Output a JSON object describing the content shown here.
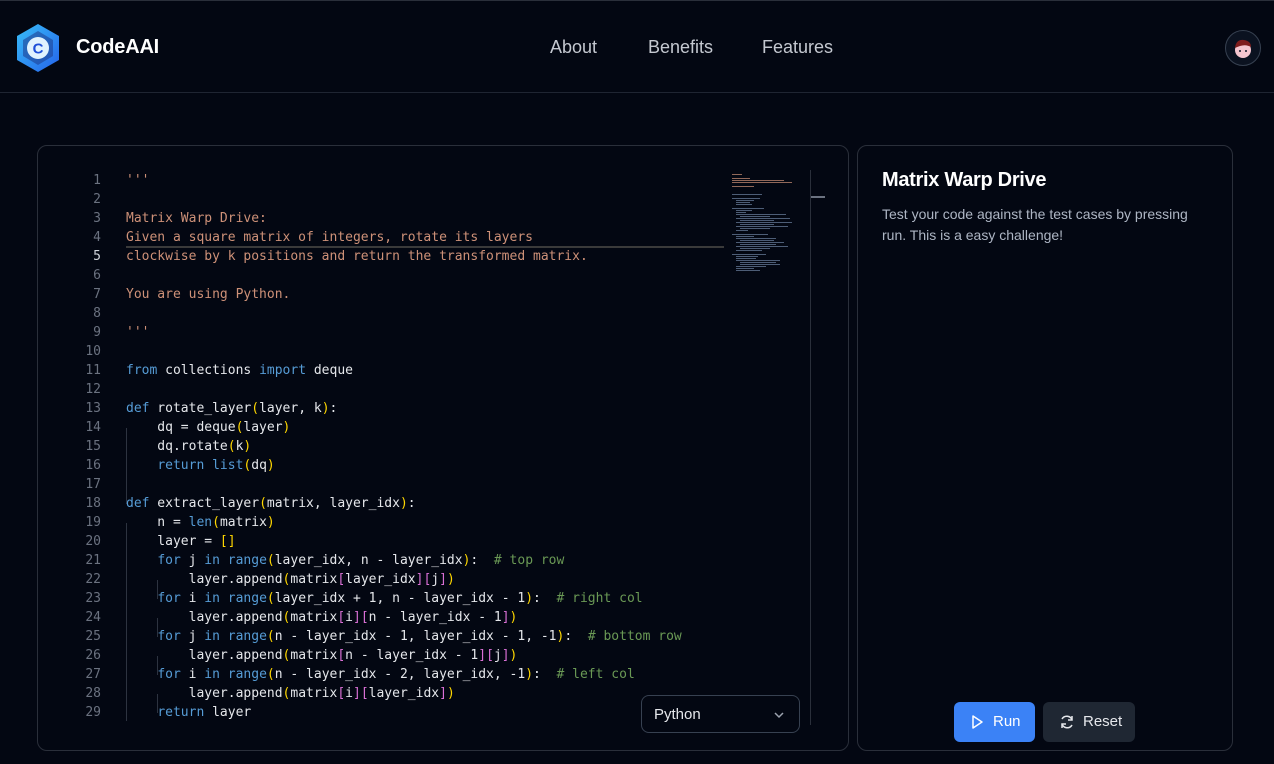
{
  "header": {
    "brand": "CodeAAI",
    "logo_letter": "C",
    "nav": [
      "About",
      "Benefits",
      "Features"
    ]
  },
  "editor": {
    "lines": [
      {
        "n": "1",
        "segs": [
          {
            "t": "'''",
            "c": "doc"
          }
        ]
      },
      {
        "n": "2",
        "segs": []
      },
      {
        "n": "3",
        "segs": [
          {
            "t": "Matrix Warp Drive:",
            "c": "doc"
          }
        ]
      },
      {
        "n": "4",
        "segs": [
          {
            "t": "Given a square matrix of integers, rotate its layers",
            "c": "doc"
          }
        ]
      },
      {
        "n": "5",
        "segs": [
          {
            "t": "clockwise by k positions and return the transformed matrix.",
            "c": "doc"
          }
        ]
      },
      {
        "n": "6",
        "segs": []
      },
      {
        "n": "7",
        "segs": [
          {
            "t": "You are using Python.",
            "c": "doc"
          }
        ]
      },
      {
        "n": "8",
        "segs": []
      },
      {
        "n": "9",
        "segs": [
          {
            "t": "'''",
            "c": "doc"
          }
        ]
      },
      {
        "n": "10",
        "segs": []
      },
      {
        "n": "11",
        "segs": [
          {
            "t": "from",
            "c": "kw"
          },
          {
            "t": " collections "
          },
          {
            "t": "import",
            "c": "kw"
          },
          {
            "t": " deque"
          }
        ]
      },
      {
        "n": "12",
        "segs": []
      },
      {
        "n": "13",
        "segs": [
          {
            "t": "def",
            "c": "kw"
          },
          {
            "t": " rotate_layer"
          },
          {
            "t": "(",
            "c": "b1"
          },
          {
            "t": "layer, k"
          },
          {
            "t": ")",
            "c": "b1"
          },
          {
            "t": ":"
          }
        ]
      },
      {
        "n": "14",
        "segs": [
          {
            "t": "    dq = deque"
          },
          {
            "t": "(",
            "c": "b1"
          },
          {
            "t": "layer"
          },
          {
            "t": ")",
            "c": "b1"
          }
        ]
      },
      {
        "n": "15",
        "segs": [
          {
            "t": "    dq.rotate"
          },
          {
            "t": "(",
            "c": "b1"
          },
          {
            "t": "k"
          },
          {
            "t": ")",
            "c": "b1"
          }
        ]
      },
      {
        "n": "16",
        "segs": [
          {
            "t": "    "
          },
          {
            "t": "return",
            "c": "kw"
          },
          {
            "t": " "
          },
          {
            "t": "list",
            "c": "kw"
          },
          {
            "t": "(",
            "c": "b1"
          },
          {
            "t": "dq"
          },
          {
            "t": ")",
            "c": "b1"
          }
        ]
      },
      {
        "n": "17",
        "segs": []
      },
      {
        "n": "18",
        "segs": [
          {
            "t": "def",
            "c": "kw"
          },
          {
            "t": " extract_layer"
          },
          {
            "t": "(",
            "c": "b1"
          },
          {
            "t": "matrix, layer_idx"
          },
          {
            "t": ")",
            "c": "b1"
          },
          {
            "t": ":"
          }
        ]
      },
      {
        "n": "19",
        "segs": [
          {
            "t": "    n = "
          },
          {
            "t": "len",
            "c": "kw"
          },
          {
            "t": "(",
            "c": "b1"
          },
          {
            "t": "matrix"
          },
          {
            "t": ")",
            "c": "b1"
          }
        ]
      },
      {
        "n": "20",
        "segs": [
          {
            "t": "    layer = "
          },
          {
            "t": "[]",
            "c": "b1"
          }
        ]
      },
      {
        "n": "21",
        "segs": [
          {
            "t": "    "
          },
          {
            "t": "for",
            "c": "kw"
          },
          {
            "t": " j "
          },
          {
            "t": "in",
            "c": "kw"
          },
          {
            "t": " "
          },
          {
            "t": "range",
            "c": "kw"
          },
          {
            "t": "(",
            "c": "b1"
          },
          {
            "t": "layer_idx, n - layer_idx"
          },
          {
            "t": ")",
            "c": "b1"
          },
          {
            "t": ":  "
          },
          {
            "t": "# top row",
            "c": "cm"
          }
        ]
      },
      {
        "n": "22",
        "segs": [
          {
            "t": "        layer.append"
          },
          {
            "t": "(",
            "c": "b1"
          },
          {
            "t": "matrix"
          },
          {
            "t": "[",
            "c": "b2"
          },
          {
            "t": "layer_idx"
          },
          {
            "t": "]",
            "c": "b2"
          },
          {
            "t": "[",
            "c": "b2"
          },
          {
            "t": "j"
          },
          {
            "t": "]",
            "c": "b2"
          },
          {
            "t": ")",
            "c": "b1"
          }
        ]
      },
      {
        "n": "23",
        "segs": [
          {
            "t": "    "
          },
          {
            "t": "for",
            "c": "kw"
          },
          {
            "t": " i "
          },
          {
            "t": "in",
            "c": "kw"
          },
          {
            "t": " "
          },
          {
            "t": "range",
            "c": "kw"
          },
          {
            "t": "(",
            "c": "b1"
          },
          {
            "t": "layer_idx + 1, n - layer_idx - 1"
          },
          {
            "t": ")",
            "c": "b1"
          },
          {
            "t": ":  "
          },
          {
            "t": "# right col",
            "c": "cm"
          }
        ]
      },
      {
        "n": "24",
        "segs": [
          {
            "t": "        layer.append"
          },
          {
            "t": "(",
            "c": "b1"
          },
          {
            "t": "matrix"
          },
          {
            "t": "[",
            "c": "b2"
          },
          {
            "t": "i"
          },
          {
            "t": "]",
            "c": "b2"
          },
          {
            "t": "[",
            "c": "b2"
          },
          {
            "t": "n - layer_idx - 1"
          },
          {
            "t": "]",
            "c": "b2"
          },
          {
            "t": ")",
            "c": "b1"
          }
        ]
      },
      {
        "n": "25",
        "segs": [
          {
            "t": "    "
          },
          {
            "t": "for",
            "c": "kw"
          },
          {
            "t": " j "
          },
          {
            "t": "in",
            "c": "kw"
          },
          {
            "t": " "
          },
          {
            "t": "range",
            "c": "kw"
          },
          {
            "t": "(",
            "c": "b1"
          },
          {
            "t": "n - layer_idx - 1, layer_idx - 1, -1"
          },
          {
            "t": ")",
            "c": "b1"
          },
          {
            "t": ":  "
          },
          {
            "t": "# bottom row",
            "c": "cm"
          }
        ]
      },
      {
        "n": "26",
        "segs": [
          {
            "t": "        layer.append"
          },
          {
            "t": "(",
            "c": "b1"
          },
          {
            "t": "matrix"
          },
          {
            "t": "[",
            "c": "b2"
          },
          {
            "t": "n - layer_idx - 1"
          },
          {
            "t": "]",
            "c": "b2"
          },
          {
            "t": "[",
            "c": "b2"
          },
          {
            "t": "j"
          },
          {
            "t": "]",
            "c": "b2"
          },
          {
            "t": ")",
            "c": "b1"
          }
        ]
      },
      {
        "n": "27",
        "segs": [
          {
            "t": "    "
          },
          {
            "t": "for",
            "c": "kw"
          },
          {
            "t": " i "
          },
          {
            "t": "in",
            "c": "kw"
          },
          {
            "t": " "
          },
          {
            "t": "range",
            "c": "kw"
          },
          {
            "t": "(",
            "c": "b1"
          },
          {
            "t": "n - layer_idx - 2, layer_idx, -1"
          },
          {
            "t": ")",
            "c": "b1"
          },
          {
            "t": ":  "
          },
          {
            "t": "# left col",
            "c": "cm"
          }
        ]
      },
      {
        "n": "28",
        "segs": [
          {
            "t": "        layer.append"
          },
          {
            "t": "(",
            "c": "b1"
          },
          {
            "t": "matrix"
          },
          {
            "t": "[",
            "c": "b2"
          },
          {
            "t": "i"
          },
          {
            "t": "]",
            "c": "b2"
          },
          {
            "t": "[",
            "c": "b2"
          },
          {
            "t": "layer_idx"
          },
          {
            "t": "]",
            "c": "b2"
          },
          {
            "t": ")",
            "c": "b1"
          }
        ]
      },
      {
        "n": "29",
        "segs": [
          {
            "t": "    "
          },
          {
            "t": "return",
            "c": "kw"
          },
          {
            "t": " layer"
          }
        ]
      }
    ],
    "active_line": "5",
    "language_select": {
      "value": "Python"
    }
  },
  "challenge": {
    "title": "Matrix Warp Drive",
    "description": "Test your code against the test cases by pressing run. This is a easy challenge!",
    "run_label": "Run",
    "reset_label": "Reset"
  },
  "colors": {
    "background": "#030712",
    "accent": "#3b82f6",
    "docstring": "#ce9178",
    "keyword": "#569cd6",
    "comment": "#6a9955",
    "bracket_1": "#ffd700",
    "bracket_2": "#da70d6"
  },
  "icons": [
    "codeaai-logo",
    "user-avatar",
    "chevron-down-icon",
    "play-icon",
    "refresh-icon"
  ]
}
